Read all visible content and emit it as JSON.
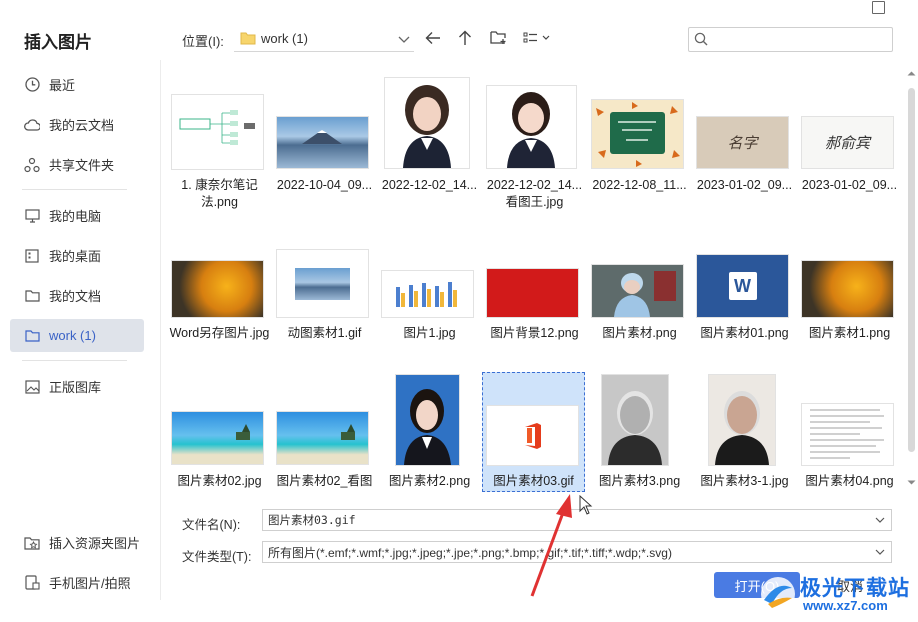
{
  "dialog": {
    "title": "插入图片"
  },
  "sidebar": {
    "items": [
      {
        "label": "最近",
        "icon": "clock-icon"
      },
      {
        "label": "我的云文档",
        "icon": "cloud-icon"
      },
      {
        "label": "共享文件夹",
        "icon": "share-icon"
      },
      {
        "label": "我的电脑",
        "icon": "computer-icon"
      },
      {
        "label": "我的桌面",
        "icon": "desktop-icon"
      },
      {
        "label": "我的文档",
        "icon": "folder-icon"
      },
      {
        "label": "work (1)",
        "icon": "folder-icon",
        "active": true
      },
      {
        "label": "正版图库",
        "icon": "gallery-icon"
      },
      {
        "label": "插入资源夹图片",
        "icon": "star-folder-icon"
      },
      {
        "label": "手机图片/拍照",
        "icon": "phone-icon"
      }
    ]
  },
  "toolbar": {
    "location_label": "位置(I):",
    "location_value": "work (1)",
    "search_placeholder": ""
  },
  "files": {
    "row1": [
      {
        "name": "1. 康奈尔笔记法.png"
      },
      {
        "name": "2022-10-04_09..."
      },
      {
        "name": "2022-12-02_14..."
      },
      {
        "name": "2022-12-02_14...看图王.jpg"
      },
      {
        "name": "2022-12-08_11..."
      },
      {
        "name": "2023-01-02_09..."
      },
      {
        "name": "2023-01-02_09..."
      }
    ],
    "row2": [
      {
        "name": "Word另存图片.jpg"
      },
      {
        "name": "动图素材1.gif"
      },
      {
        "name": "图片1.jpg"
      },
      {
        "name": "图片背景12.png"
      },
      {
        "name": "图片素材.png"
      },
      {
        "name": "图片素材01.png"
      },
      {
        "name": "图片素材1.png"
      }
    ],
    "row3": [
      {
        "name": "图片素材02.jpg"
      },
      {
        "name": "图片素材02_看图"
      },
      {
        "name": "图片素材2.png"
      },
      {
        "name": "图片素材03.gif",
        "selected": true
      },
      {
        "name": "图片素材3.png"
      },
      {
        "name": "图片素材3-1.jpg"
      },
      {
        "name": "图片素材04.png"
      }
    ],
    "thumb_texts": {
      "sig1": "名字",
      "sig2": "郝俞宾",
      "word_icon": "W"
    }
  },
  "form": {
    "filename_label": "文件名(N):",
    "filename_value": "图片素材03.gif",
    "filetype_label": "文件类型(T):",
    "filetype_value": "所有图片(*.emf;*.wmf;*.jpg;*.jpeg;*.jpe;*.png;*.bmp;*.gif;*.tif;*.tiff;*.wdp;*.svg)",
    "open_label": "打开(O)",
    "cancel_label": "取消"
  },
  "watermark": {
    "line1": "极光下载站",
    "line2": "www.xz7.com"
  },
  "colors": {
    "accent": "#4a7be3",
    "selection": "#cfe3fa",
    "arrow": "#e03232"
  }
}
